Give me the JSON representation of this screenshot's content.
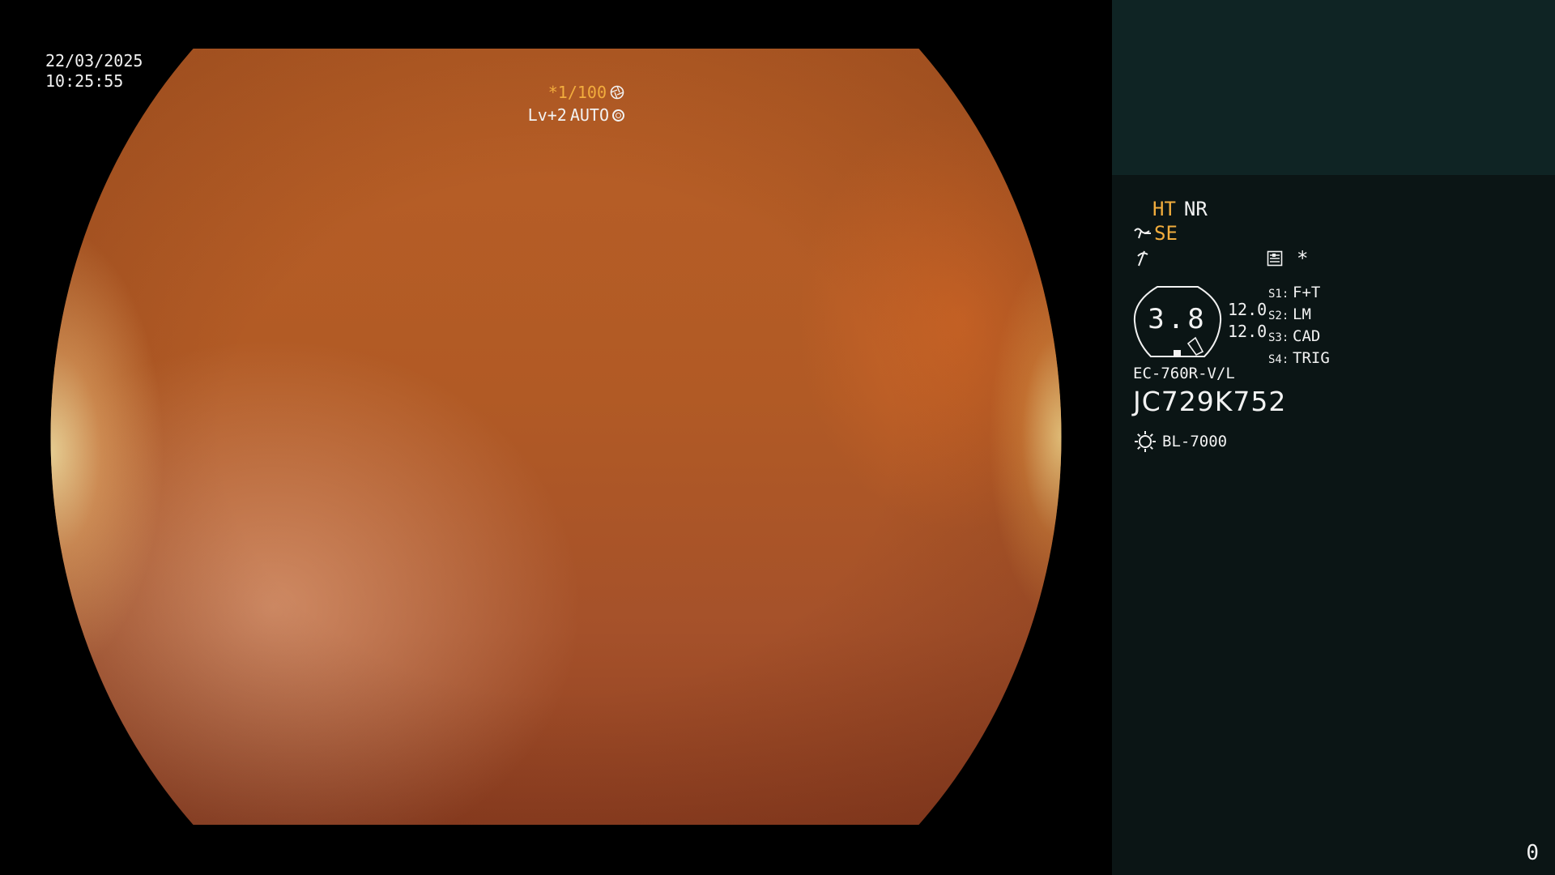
{
  "overlay": {
    "date": "22/03/2025",
    "time": "10:25:55",
    "shutter": "*1/100",
    "iris_level": "Lv+2",
    "iris_mode": "AUTO"
  },
  "panel": {
    "ht": "HT",
    "nr": "NR",
    "se": "SE",
    "memory_mark": "*",
    "scope_value": "3.8",
    "scope_num_1": "12.0",
    "scope_num_2": "12.0",
    "switches": [
      {
        "key": "S1:",
        "value": "F+T"
      },
      {
        "key": "S2:",
        "value": "LM"
      },
      {
        "key": "S3:",
        "value": "CAD"
      },
      {
        "key": "S4:",
        "value": "TRIG"
      }
    ],
    "scope_model": "EC-760R-V/L",
    "serial": "JC729K752",
    "light_source": "BL-7000",
    "counter": "0"
  },
  "colors": {
    "accent_orange": "#f2ad3d",
    "panel_bg": "#0b1515",
    "panel_top_bg": "#0f2424",
    "image_base": "#b15a25"
  },
  "icons": {
    "shutter": "aperture-icon",
    "iris": "iris-ring-icon",
    "se": "structure-enhance-icon",
    "flash": "flash-icon",
    "memory": "memory-icon",
    "light": "sun-icon"
  }
}
